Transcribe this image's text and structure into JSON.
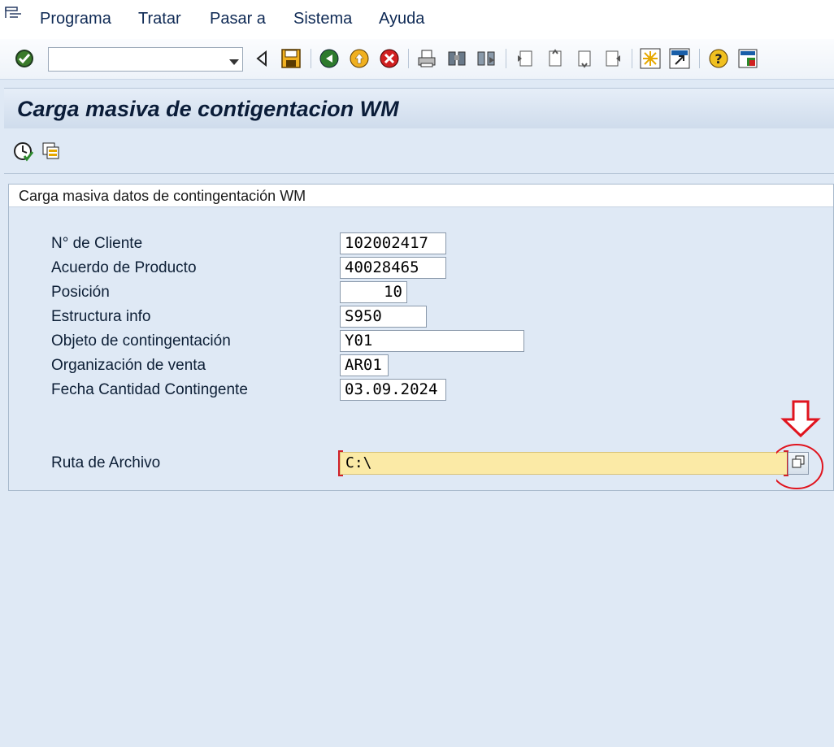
{
  "menu": {
    "items": [
      {
        "label": "Programa"
      },
      {
        "label": "Tratar"
      },
      {
        "label": "Pasar a"
      },
      {
        "label": "Sistema"
      },
      {
        "label": "Ayuda"
      }
    ]
  },
  "toolbar": {
    "command_field_value": "",
    "icons": [
      "enter-icon",
      "back-nav-icon",
      "save-icon",
      "back-icon",
      "exit-icon",
      "cancel-icon",
      "print-icon",
      "find-icon",
      "find-next-icon",
      "first-page-icon",
      "previous-page-icon",
      "next-page-icon",
      "last-page-icon",
      "create-session-icon",
      "shortcut-icon",
      "help-icon",
      "customize-layout-icon"
    ]
  },
  "title": "Carga masiva de contigentacion WM",
  "app_toolbar": {
    "icons": [
      "execute-icon",
      "variants-icon"
    ]
  },
  "group": {
    "title": "Carga masiva datos de contingentación WM"
  },
  "fields": {
    "cliente": {
      "label": "N° de Cliente",
      "value": "102002417"
    },
    "acuerdo": {
      "label": "Acuerdo de Producto",
      "value": "40028465"
    },
    "posicion": {
      "label": "Posición",
      "value": "10"
    },
    "estructura": {
      "label": "Estructura info",
      "value": "S950"
    },
    "objeto": {
      "label": "Objeto de contingentación",
      "value": "Y01"
    },
    "organizacion": {
      "label": "Organización de venta",
      "value": "AR01"
    },
    "fecha": {
      "label": "Fecha Cantidad Contingente",
      "value": "03.09.2024"
    },
    "ruta": {
      "label": "Ruta de Archivo",
      "value": "C:\\"
    }
  },
  "colors": {
    "annotation": "#e0141e",
    "required_field_bg": "#fbeaa6",
    "background": "#dfe9f5"
  }
}
